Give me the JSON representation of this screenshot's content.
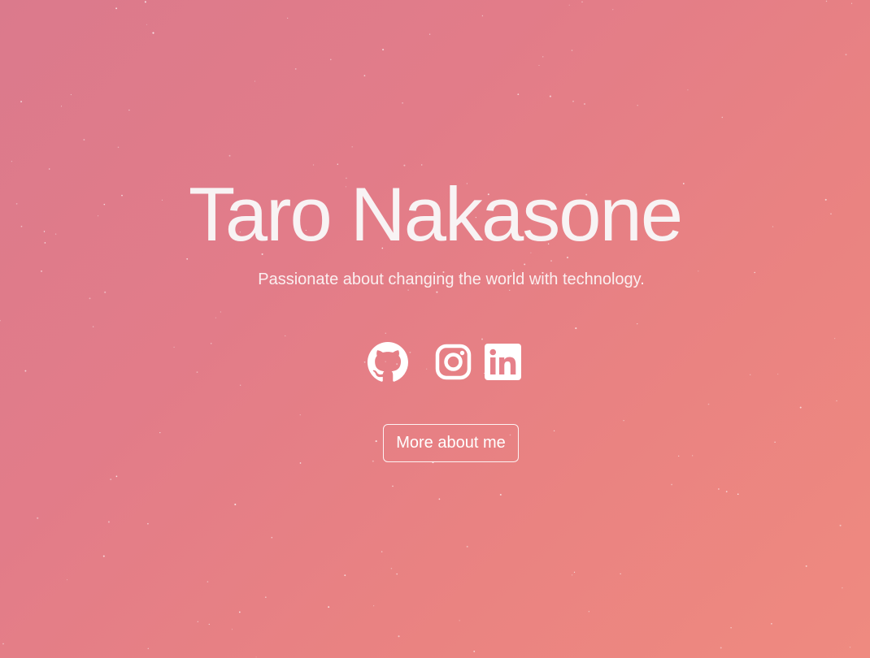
{
  "hero": {
    "name": "Taro Nakasone",
    "tagline": "Passionate about changing the world with technology.",
    "more_button_label": "More about me"
  },
  "social_links": [
    {
      "icon": "github-icon"
    },
    {
      "icon": "instagram-icon"
    },
    {
      "icon": "linkedin-icon"
    }
  ],
  "colors": {
    "gradient_start": "#db7a8c",
    "gradient_end": "#ef8a80",
    "text": "#ffffff"
  }
}
